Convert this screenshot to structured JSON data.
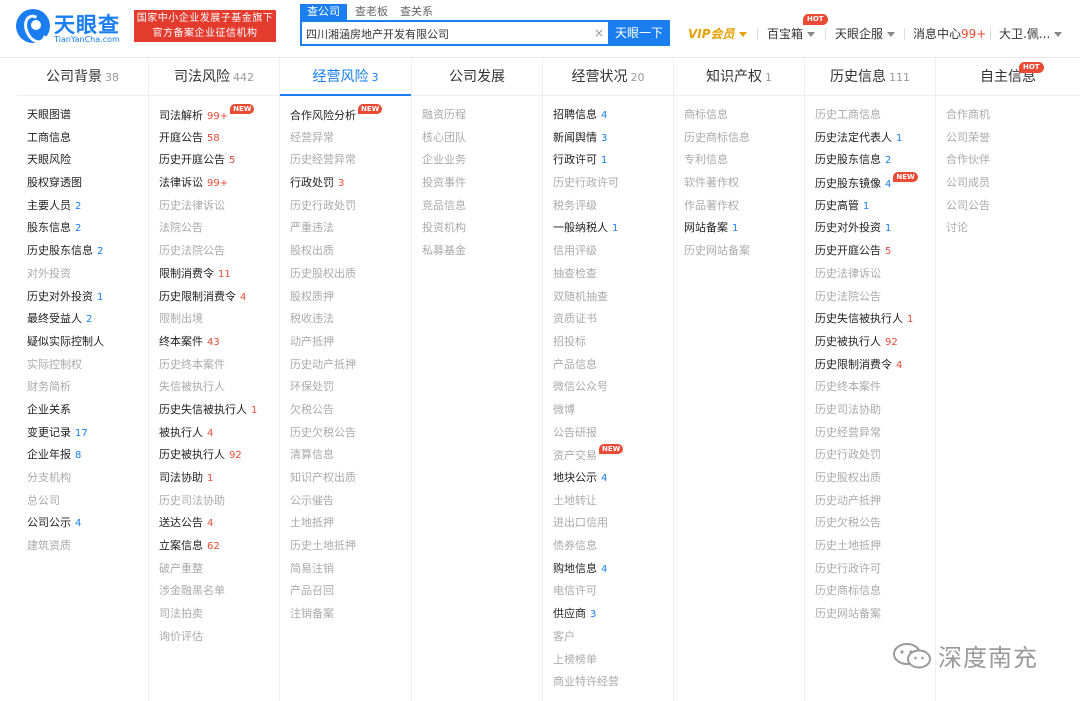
{
  "logo": {
    "name": "天眼查",
    "sub": "TianYanCha.com"
  },
  "banner": {
    "line1": "国家中小企业发展子基金旗下",
    "line2": "官方备案企业征信机构"
  },
  "search": {
    "tabs": [
      "查公司",
      "查老板",
      "查关系"
    ],
    "value": "四川湘涵房地产开发有限公司",
    "button": "天眼一下"
  },
  "nav": {
    "vip": "VIP会员",
    "treasure": "百宝箱",
    "enterprise": "天眼企服",
    "message": "消息中心",
    "message_count": "99+",
    "user": "大卫.佩...",
    "hot": "HOT"
  },
  "colors": {
    "brand": "#1a7ef0",
    "accent": "#e94b35",
    "vip": "#e6a000"
  },
  "columns": [
    {
      "title": "公司背景",
      "count": "38",
      "items": [
        {
          "label": "天眼图谱",
          "on": true
        },
        {
          "label": "工商信息",
          "on": true
        },
        {
          "label": "天眼风险",
          "on": true
        },
        {
          "label": "股权穿透图",
          "on": true
        },
        {
          "label": "主要人员",
          "count": "2",
          "on": true
        },
        {
          "label": "股东信息",
          "count": "2",
          "on": true
        },
        {
          "label": "历史股东信息",
          "count": "2",
          "on": true
        },
        {
          "label": "对外投资",
          "on": false
        },
        {
          "label": "历史对外投资",
          "count": "1",
          "on": true
        },
        {
          "label": "最终受益人",
          "count": "2",
          "on": true
        },
        {
          "label": "疑似实际控制人",
          "on": true
        },
        {
          "label": "实际控制权",
          "on": false
        },
        {
          "label": "财务简析",
          "on": false
        },
        {
          "label": "企业关系",
          "on": true
        },
        {
          "label": "变更记录",
          "count": "17",
          "on": true
        },
        {
          "label": "企业年报",
          "count": "8",
          "on": true
        },
        {
          "label": "分支机构",
          "on": false
        },
        {
          "label": "总公司",
          "on": false
        },
        {
          "label": "公司公示",
          "count": "4",
          "on": true
        },
        {
          "label": "建筑资质",
          "on": false
        }
      ]
    },
    {
      "title": "司法风险",
      "count": "442",
      "items": [
        {
          "label": "司法解析",
          "count": "99+",
          "red": true,
          "new": true,
          "on": true
        },
        {
          "label": "开庭公告",
          "count": "58",
          "red": true,
          "on": true
        },
        {
          "label": "历史开庭公告",
          "count": "5",
          "red": true,
          "on": true
        },
        {
          "label": "法律诉讼",
          "count": "99+",
          "red": true,
          "on": true
        },
        {
          "label": "历史法律诉讼",
          "on": false
        },
        {
          "label": "法院公告",
          "on": false
        },
        {
          "label": "历史法院公告",
          "on": false
        },
        {
          "label": "限制消费令",
          "count": "11",
          "red": true,
          "on": true
        },
        {
          "label": "历史限制消费令",
          "count": "4",
          "red": true,
          "on": true
        },
        {
          "label": "限制出境",
          "on": false
        },
        {
          "label": "终本案件",
          "count": "43",
          "red": true,
          "on": true
        },
        {
          "label": "历史终本案件",
          "on": false
        },
        {
          "label": "失信被执行人",
          "on": false
        },
        {
          "label": "历史失信被执行人",
          "count": "1",
          "red": true,
          "on": true
        },
        {
          "label": "被执行人",
          "count": "4",
          "red": true,
          "on": true
        },
        {
          "label": "历史被执行人",
          "count": "92",
          "red": true,
          "on": true
        },
        {
          "label": "司法协助",
          "count": "1",
          "red": true,
          "on": true
        },
        {
          "label": "历史司法协助",
          "on": false
        },
        {
          "label": "送达公告",
          "count": "4",
          "red": true,
          "on": true
        },
        {
          "label": "立案信息",
          "count": "62",
          "red": true,
          "on": true
        },
        {
          "label": "破产重整",
          "on": false
        },
        {
          "label": "涉金融黑名单",
          "on": false
        },
        {
          "label": "司法拍卖",
          "on": false
        },
        {
          "label": "询价评估",
          "on": false
        }
      ]
    },
    {
      "title": "经营风险",
      "count": "3",
      "active": true,
      "items": [
        {
          "label": "合作风险分析",
          "new": true,
          "on": true
        },
        {
          "label": "经营异常",
          "on": false
        },
        {
          "label": "历史经营异常",
          "on": false
        },
        {
          "label": "行政处罚",
          "count": "3",
          "red": true,
          "on": true
        },
        {
          "label": "历史行政处罚",
          "on": false
        },
        {
          "label": "严重违法",
          "on": false
        },
        {
          "label": "股权出质",
          "on": false
        },
        {
          "label": "历史股权出质",
          "on": false
        },
        {
          "label": "股权质押",
          "on": false
        },
        {
          "label": "税收违法",
          "on": false
        },
        {
          "label": "动产抵押",
          "on": false
        },
        {
          "label": "历史动产抵押",
          "on": false
        },
        {
          "label": "环保处罚",
          "on": false
        },
        {
          "label": "欠税公告",
          "on": false
        },
        {
          "label": "历史欠税公告",
          "on": false
        },
        {
          "label": "清算信息",
          "on": false
        },
        {
          "label": "知识产权出质",
          "on": false
        },
        {
          "label": "公示催告",
          "on": false
        },
        {
          "label": "土地抵押",
          "on": false
        },
        {
          "label": "历史土地抵押",
          "on": false
        },
        {
          "label": "简易注销",
          "on": false
        },
        {
          "label": "产品召回",
          "on": false
        },
        {
          "label": "注销备案",
          "on": false
        }
      ]
    },
    {
      "title": "公司发展",
      "count": "",
      "items": [
        {
          "label": "融资历程",
          "on": false
        },
        {
          "label": "核心团队",
          "on": false
        },
        {
          "label": "企业业务",
          "on": false
        },
        {
          "label": "投资事件",
          "on": false
        },
        {
          "label": "竞品信息",
          "on": false
        },
        {
          "label": "投资机构",
          "on": false
        },
        {
          "label": "私募基金",
          "on": false
        }
      ]
    },
    {
      "title": "经营状况",
      "count": "20",
      "items": [
        {
          "label": "招聘信息",
          "count": "4",
          "on": true
        },
        {
          "label": "新闻舆情",
          "count": "3",
          "on": true
        },
        {
          "label": "行政许可",
          "count": "1",
          "on": true
        },
        {
          "label": "历史行政许可",
          "on": false
        },
        {
          "label": "税务评级",
          "on": false
        },
        {
          "label": "一般纳税人",
          "count": "1",
          "on": true
        },
        {
          "label": "信用评级",
          "on": false
        },
        {
          "label": "抽查检查",
          "on": false
        },
        {
          "label": "双随机抽查",
          "on": false
        },
        {
          "label": "资质证书",
          "on": false
        },
        {
          "label": "招投标",
          "on": false
        },
        {
          "label": "产品信息",
          "on": false
        },
        {
          "label": "微信公众号",
          "on": false
        },
        {
          "label": "微博",
          "on": false
        },
        {
          "label": "公告研报",
          "on": false
        },
        {
          "label": "资产交易",
          "new": true,
          "on": false
        },
        {
          "label": "地块公示",
          "count": "4",
          "on": true
        },
        {
          "label": "土地转让",
          "on": false
        },
        {
          "label": "进出口信用",
          "on": false
        },
        {
          "label": "债券信息",
          "on": false
        },
        {
          "label": "购地信息",
          "count": "4",
          "on": true
        },
        {
          "label": "电信许可",
          "on": false
        },
        {
          "label": "供应商",
          "count": "3",
          "on": true
        },
        {
          "label": "客户",
          "on": false
        },
        {
          "label": "上榜榜单",
          "on": false
        },
        {
          "label": "商业特许经营",
          "on": false
        }
      ]
    },
    {
      "title": "知识产权",
      "count": "1",
      "items": [
        {
          "label": "商标信息",
          "on": false
        },
        {
          "label": "历史商标信息",
          "on": false
        },
        {
          "label": "专利信息",
          "on": false
        },
        {
          "label": "软件著作权",
          "on": false
        },
        {
          "label": "作品著作权",
          "on": false
        },
        {
          "label": "网站备案",
          "count": "1",
          "on": true
        },
        {
          "label": "历史网站备案",
          "on": false
        }
      ]
    },
    {
      "title": "历史信息",
      "count": "111",
      "items": [
        {
          "label": "历史工商信息",
          "on": false
        },
        {
          "label": "历史法定代表人",
          "count": "1",
          "on": true
        },
        {
          "label": "历史股东信息",
          "count": "2",
          "on": true
        },
        {
          "label": "历史股东镜像",
          "count": "4",
          "new": true,
          "on": true
        },
        {
          "label": "历史高管",
          "count": "1",
          "on": true
        },
        {
          "label": "历史对外投资",
          "count": "1",
          "on": true
        },
        {
          "label": "历史开庭公告",
          "count": "5",
          "red": true,
          "on": true
        },
        {
          "label": "历史法律诉讼",
          "on": false
        },
        {
          "label": "历史法院公告",
          "on": false
        },
        {
          "label": "历史失信被执行人",
          "count": "1",
          "red": true,
          "on": true
        },
        {
          "label": "历史被执行人",
          "count": "92",
          "red": true,
          "on": true
        },
        {
          "label": "历史限制消费令",
          "count": "4",
          "red": true,
          "on": true
        },
        {
          "label": "历史终本案件",
          "on": false
        },
        {
          "label": "历史司法协助",
          "on": false
        },
        {
          "label": "历史经营异常",
          "on": false
        },
        {
          "label": "历史行政处罚",
          "on": false
        },
        {
          "label": "历史股权出质",
          "on": false
        },
        {
          "label": "历史动产抵押",
          "on": false
        },
        {
          "label": "历史欠税公告",
          "on": false
        },
        {
          "label": "历史土地抵押",
          "on": false
        },
        {
          "label": "历史行政许可",
          "on": false
        },
        {
          "label": "历史商标信息",
          "on": false
        },
        {
          "label": "历史网站备案",
          "on": false
        }
      ]
    },
    {
      "title": "自主信息",
      "count": "",
      "hot": true,
      "items": [
        {
          "label": "合作商机",
          "on": false
        },
        {
          "label": "公司荣誉",
          "on": false
        },
        {
          "label": "合作伙伴",
          "on": false
        },
        {
          "label": "公司成员",
          "on": false
        },
        {
          "label": "公司公告",
          "on": false
        },
        {
          "label": "讨论",
          "on": false
        }
      ]
    }
  ],
  "watermark": "深度南充"
}
